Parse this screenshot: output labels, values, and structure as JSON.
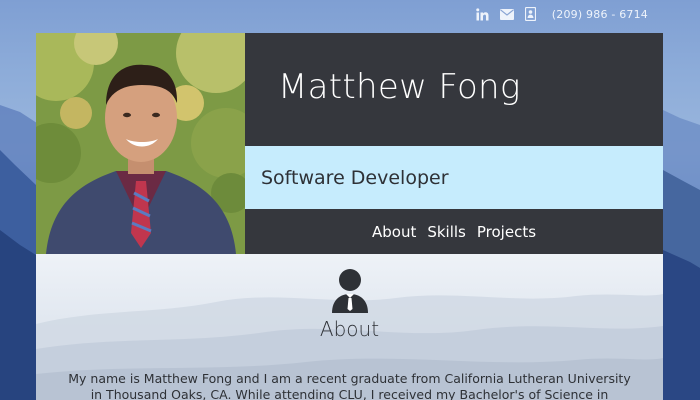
{
  "topbar": {
    "icons": [
      "linkedin-icon",
      "envelope-icon",
      "contact-card-icon"
    ],
    "phone": "(209) 986 - 6714"
  },
  "header": {
    "name": "Matthew Fong",
    "role": "Software Developer"
  },
  "nav": {
    "items": [
      {
        "label": "About"
      },
      {
        "label": "Skills"
      },
      {
        "label": "Projects"
      }
    ]
  },
  "about": {
    "icon": "user-tie-icon",
    "heading": "About",
    "text": "My name is Matthew Fong and I am a recent graduate from California Lutheran University in Thousand Oaks, CA. While attending CLU, I received my Bachelor's of Science in Computer"
  },
  "colors": {
    "dark_panel": "#35373d",
    "light_blue": "#c6ecfd",
    "text_dark": "#2e3136"
  }
}
